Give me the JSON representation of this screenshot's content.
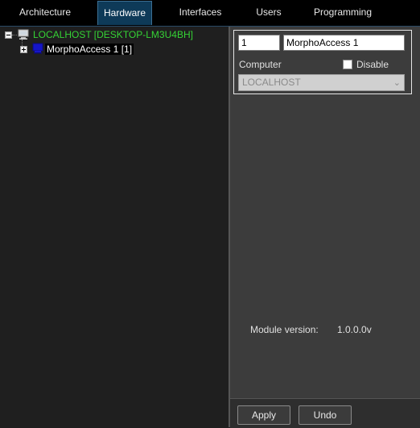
{
  "tabs": [
    {
      "label": "Architecture",
      "active": false
    },
    {
      "label": "Hardware",
      "active": true
    },
    {
      "label": "Interfaces",
      "active": false
    },
    {
      "label": "Users",
      "active": false
    },
    {
      "label": "Programming",
      "active": false
    }
  ],
  "tree": {
    "root": {
      "label": "LOCALHOST [DESKTOP-LM3U4BH]",
      "icon": "computer-icon",
      "expanded": true,
      "color": "#35d335"
    },
    "child": {
      "label": "MorphoAccess 1 [1]",
      "icon": "monitor-icon",
      "expanded": false,
      "selected": true
    }
  },
  "properties": {
    "id_value": "1",
    "name_value": "MorphoAccess 1",
    "computer_label": "Computer",
    "disable_label": "Disable",
    "disable_checked": false,
    "computer_value": "LOCALHOST",
    "module_version_label": "Module version:",
    "module_version_value": "1.0.0.0v"
  },
  "buttons": {
    "apply_label": "Apply",
    "undo_label": "Undo"
  },
  "colors": {
    "active_tab": "#0e3a58",
    "accent_green": "#35d335"
  }
}
